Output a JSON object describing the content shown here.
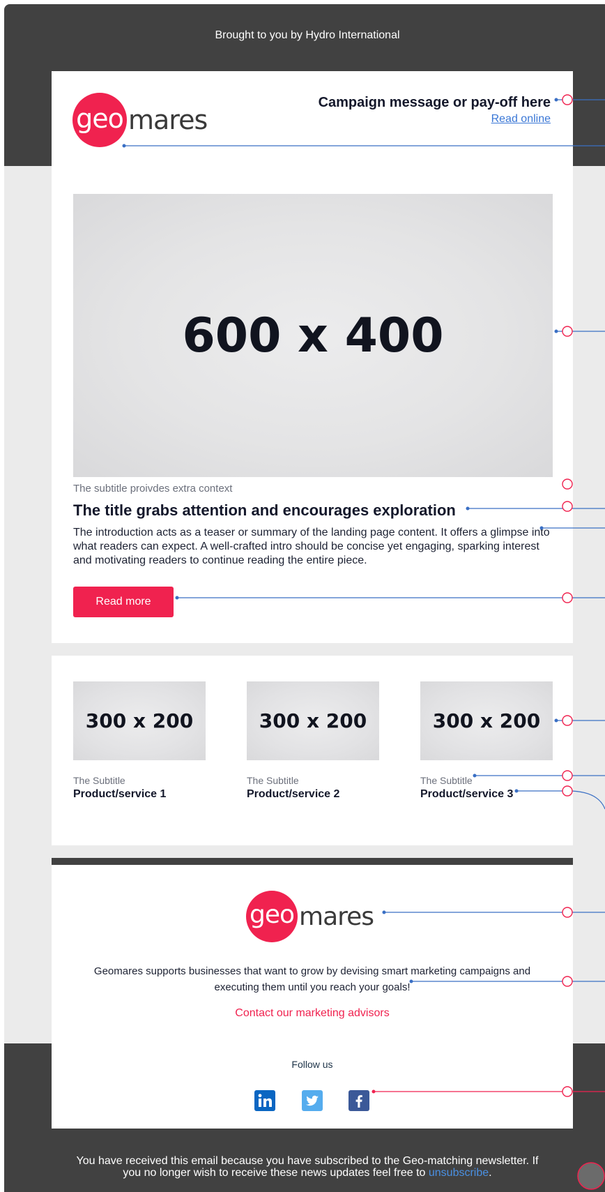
{
  "header": {
    "brought_by": "Brought to you by Hydro International",
    "logo_geo": "geo",
    "logo_mares": "mares",
    "campaign_message": "Campaign message or pay-off here",
    "read_online": "Read online"
  },
  "hero": {
    "image_placeholder": "600 x 400",
    "subtitle": "The subtitle proivdes extra context",
    "title": "The title grabs attention and encourages exploration",
    "intro": "The introduction acts as a teaser or summary of the landing page content. It offers a glimpse into what readers can expect. A well-crafted intro should be concise yet engaging, sparking interest and motivating readers to continue reading the entire piece.",
    "read_more": "Read more"
  },
  "products": [
    {
      "image_placeholder": "300 x 200",
      "subtitle": "The Subtitle",
      "name": "Product/service 1"
    },
    {
      "image_placeholder": "300 x 200",
      "subtitle": "The Subtitle",
      "name": "Product/service 2"
    },
    {
      "image_placeholder": "300 x 200",
      "subtitle": "The Subtitle",
      "name": "Product/service 3"
    }
  ],
  "footer": {
    "logo_geo": "geo",
    "logo_mares": "mares",
    "description": "Geomares supports businesses that want to grow by devising smart marketing campaigns and executing them until you reach your goals!",
    "contact_link": "Contact our marketing advisors",
    "follow_us": "Follow us",
    "social": [
      {
        "network": "linkedin",
        "icon": "linkedin-icon",
        "color": "#0a66c2"
      },
      {
        "network": "twitter",
        "icon": "twitter-icon",
        "color": "#55acee"
      },
      {
        "network": "facebook",
        "icon": "facebook-icon",
        "color": "#3b5998"
      }
    ],
    "disclaimer_text": "You have received this email because you have subscribed to the Geo-matching newsletter. If you no longer wish to receive these news updates feel free to",
    "unsubscribe": "unsubscribe",
    "disclaimer_end": "."
  },
  "colors": {
    "brand_red": "#f0224f",
    "dark_band": "#414141",
    "background": "#ebebeb",
    "link_blue": "#3a77d6",
    "annotation_blue": "#3a6fc4"
  }
}
